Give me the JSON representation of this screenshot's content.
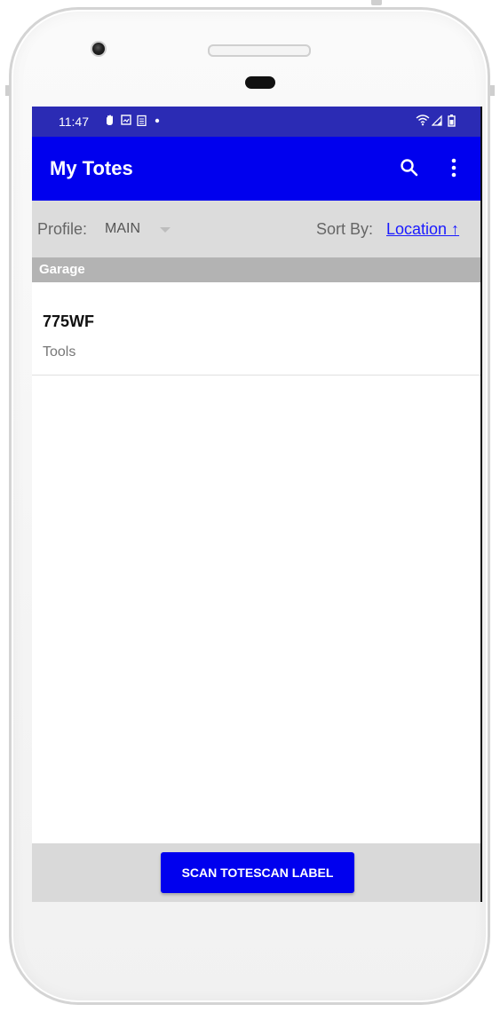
{
  "status_bar": {
    "time": "11:47",
    "notification_icons": [
      "hand-icon",
      "screenshot-icon",
      "clipboard-icon",
      "dot-icon"
    ],
    "system_icons": [
      "wifi-icon",
      "signal-icon",
      "battery-icon"
    ]
  },
  "app_bar": {
    "title": "My Totes",
    "search_icon": "search-icon",
    "more_icon": "more-vert-icon",
    "color": "#0000ee"
  },
  "filter_bar": {
    "profile_label": "Profile:",
    "profile_value": "MAIN",
    "sort_label": "Sort By:",
    "sort_value": "Location ↑"
  },
  "groups": [
    {
      "title": "Garage",
      "items": [
        {
          "id": "775WF",
          "description": "Tools"
        }
      ]
    }
  ],
  "bottom_bar": {
    "scan_button_label": "SCAN TOTESCAN LABEL"
  },
  "colors": {
    "status_bar": "#2b2bb4",
    "primary": "#0000ee",
    "link": "#1a1aff",
    "group_header": "#b3b3b3",
    "filter_bar": "#dcdcdc"
  }
}
